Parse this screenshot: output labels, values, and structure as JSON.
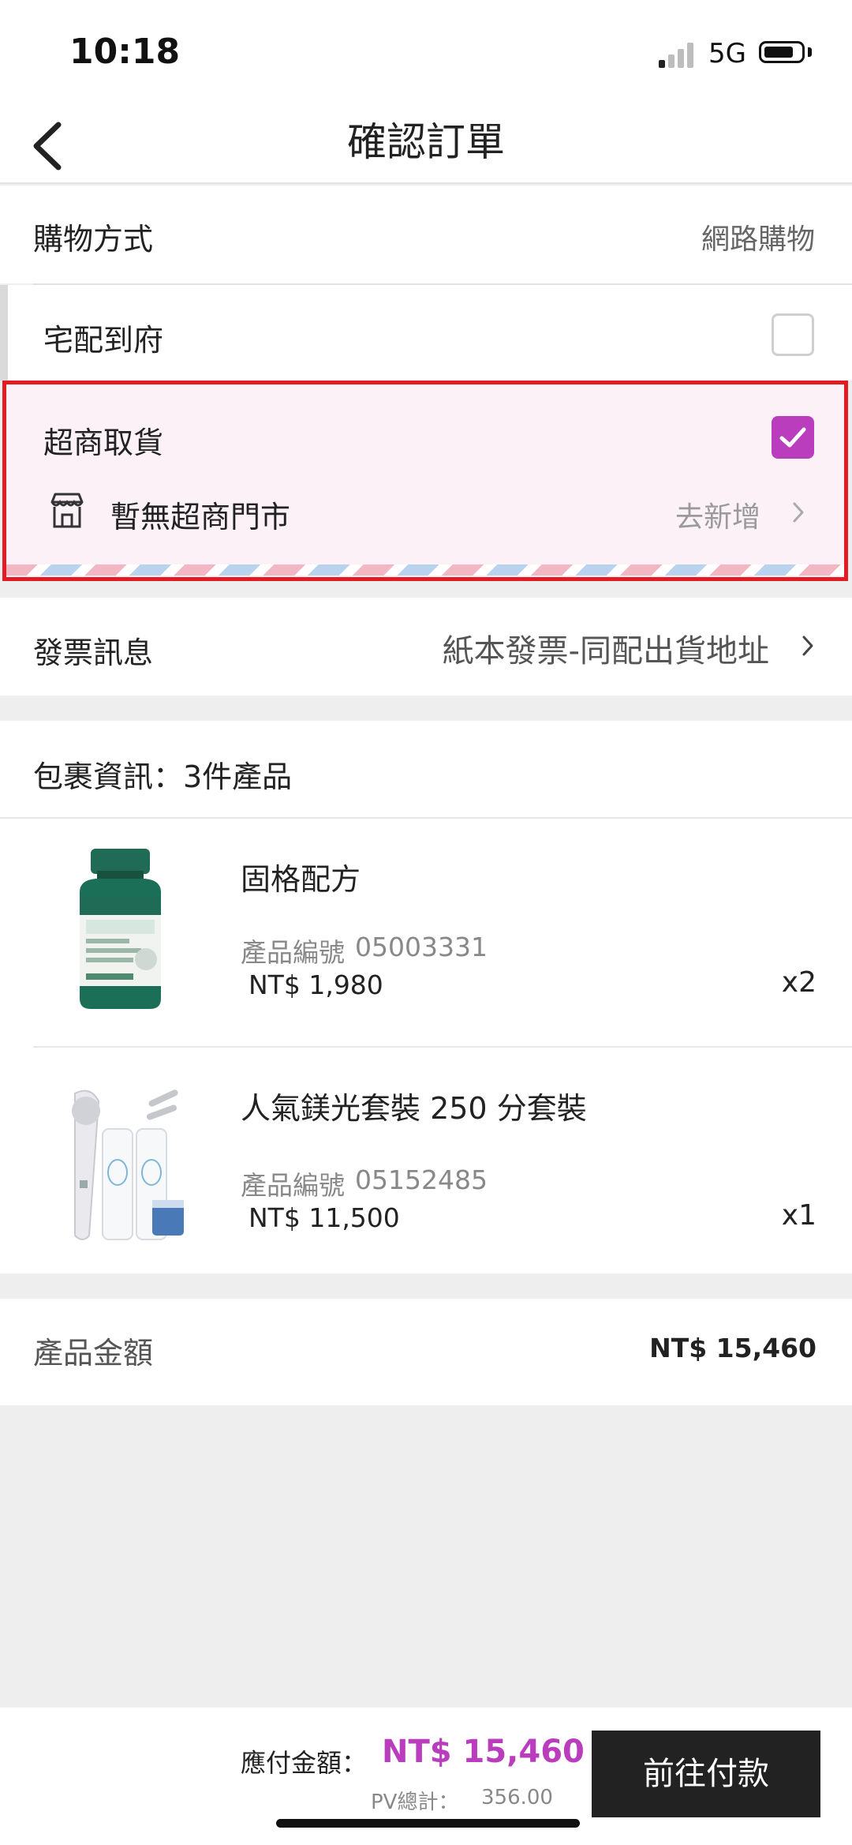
{
  "status_bar": {
    "time": "10:18",
    "network": "5G"
  },
  "header": {
    "title": "確認訂單"
  },
  "shopping_method": {
    "label": "購物方式",
    "value": "網路購物"
  },
  "delivery_options": {
    "home": {
      "label": "宅配到府",
      "checked": false
    },
    "store": {
      "label": "超商取貨",
      "checked": true,
      "store_text": "暫無超商門市",
      "add_label": "去新增"
    }
  },
  "invoice": {
    "label": "發票訊息",
    "value": "紙本發票-同配出貨地址"
  },
  "package": {
    "header": "包裹資訊：3件產品",
    "items": [
      {
        "name": "固格配方",
        "code_label": "產品編號",
        "code": "05003331",
        "price": "NT$ 1,980",
        "qty": "x2"
      },
      {
        "name": "人氣鎂光套裝 250 分套裝",
        "code_label": "產品編號",
        "code": "05152485",
        "price": "NT$ 11,500",
        "qty": "x1"
      }
    ]
  },
  "product_total": {
    "label": "產品金額",
    "value": "NT$ 15,460"
  },
  "footer": {
    "payable_label": "應付金額：",
    "payable_value": "NT$ 15,460",
    "pv_label": "PV總計：",
    "pv_value": "356.00",
    "pay_button": "前往付款"
  },
  "colors": {
    "accent": "#b93dbd",
    "highlight_border": "#e31b23",
    "button": "#222222"
  }
}
